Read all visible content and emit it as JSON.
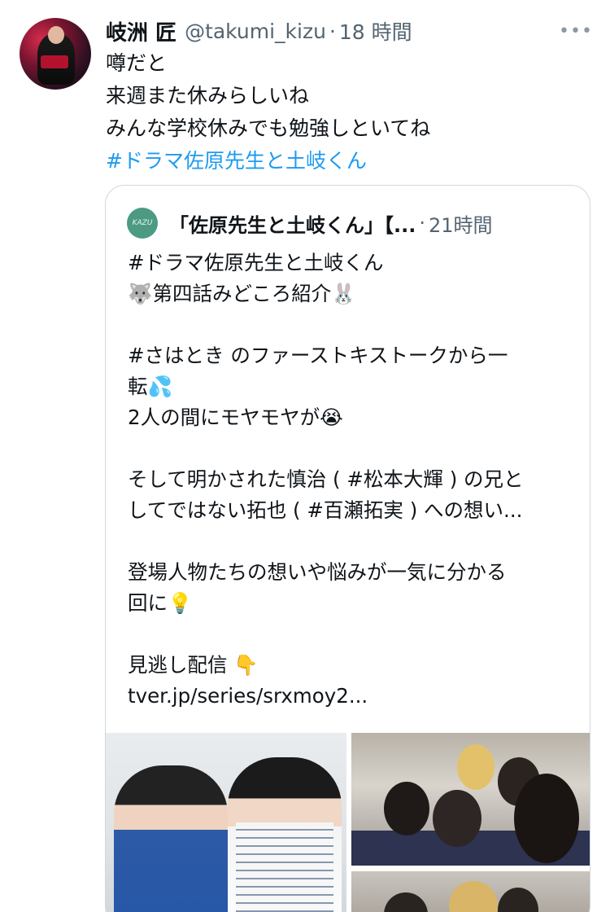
{
  "tweet": {
    "author_name": "岐洲 匠",
    "author_handle": "@takumi_kizu",
    "separator": "·",
    "timestamp": "18 時間",
    "more_icon": "more-horizontal-icon",
    "body_lines": [
      "噂だと",
      "来週また休みらしいね",
      "みんな学校休みでも勉強しといてね"
    ],
    "hashtag": "#ドラマ佐原先生と土岐くん"
  },
  "quote": {
    "avatar_text": "KAZU",
    "name": "「佐原先生と土岐くん」【...",
    "separator": "·",
    "timestamp": "21時間",
    "lines": [
      "#ドラマ佐原先生と土岐くん",
      "🐺第四話みどころ紹介🐰",
      "",
      "#さはとき のファーストキストークから一",
      "転💦",
      "2人の間にモヤモヤが😭",
      "",
      "そして明かされた慎治 ( #松本大輝 ) の兄と",
      "してではない拓也 ( #百瀬拓実 ) への想い...",
      "",
      "登場人物たちの想いや悩みが一気に分かる",
      "回に💡",
      "",
      "見逃し配信 👇",
      "tver.jp/series/srxmoy2..."
    ]
  },
  "colors": {
    "text": "#0f1419",
    "secondary": "#536471",
    "link": "#1d9bf0",
    "border": "#cfd9de"
  }
}
